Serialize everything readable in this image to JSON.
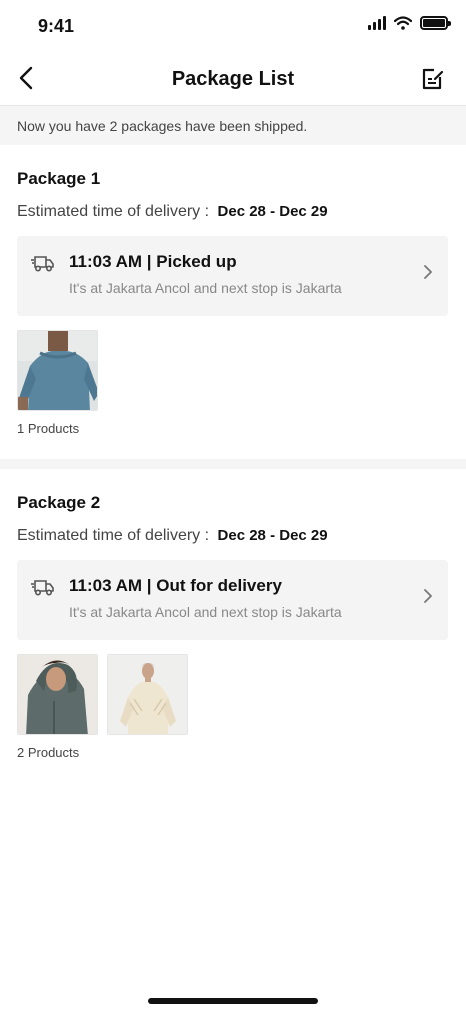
{
  "status_bar": {
    "time": "9:41"
  },
  "header": {
    "title": "Package List"
  },
  "notice": "Now you have 2 packages have been shipped.",
  "packages": [
    {
      "title": "Package 1",
      "eta_label": "Estimated time of delivery :",
      "eta_value": "Dec 28 - Dec 29",
      "tracking": {
        "status": "11:03 AM | Picked up",
        "description": "It's at Jakarta Ancol and next stop is Jakarta"
      },
      "products_count": "1 Products"
    },
    {
      "title": "Package 2",
      "eta_label": "Estimated time of delivery :",
      "eta_value": "Dec 28 - Dec 29",
      "tracking": {
        "status": "11:03 AM | Out for delivery",
        "description": "It's at Jakarta Ancol and next stop is Jakarta"
      },
      "products_count": "2 Products"
    }
  ],
  "colors": {
    "background": "#f5f5f5",
    "card": "#ffffff",
    "tracking_card": "#f4f4f4",
    "primary_text": "#111111",
    "secondary_text": "#888888"
  },
  "icons": [
    "back-arrow-icon",
    "edit-note-icon",
    "truck-icon",
    "chevron-right-icon",
    "signal-icon",
    "wifi-icon",
    "battery-icon"
  ]
}
